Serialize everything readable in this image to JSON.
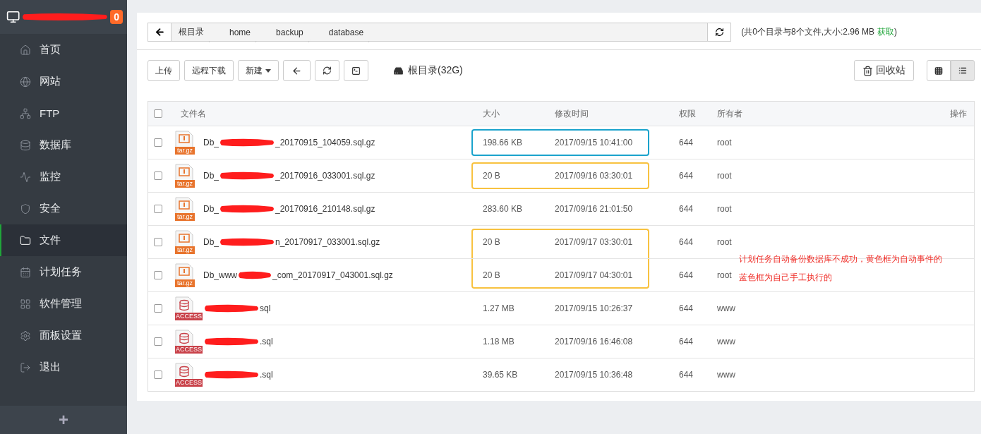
{
  "sidebar": {
    "badge": "0",
    "items": [
      {
        "label": "首页",
        "selected": false
      },
      {
        "label": "网站",
        "selected": false
      },
      {
        "label": "FTP",
        "selected": false
      },
      {
        "label": "数据库",
        "selected": false
      },
      {
        "label": "监控",
        "selected": false
      },
      {
        "label": "安全",
        "selected": false
      },
      {
        "label": "文件",
        "selected": true
      },
      {
        "label": "计划任务",
        "selected": false
      },
      {
        "label": "软件管理",
        "selected": false
      },
      {
        "label": "面板设置",
        "selected": false
      },
      {
        "label": "退出",
        "selected": false
      }
    ],
    "add": "+"
  },
  "breadcrumb": [
    "根目录",
    "home",
    "backup",
    "database"
  ],
  "summary": {
    "text": "(共0个目录与8个文件,大小:2.96 MB",
    "link": "获取",
    "close": ")"
  },
  "toolbar": {
    "buttons": [
      {
        "kind": "text",
        "label": "上传"
      },
      {
        "kind": "text",
        "label": "远程下载"
      },
      {
        "kind": "dropdown",
        "label": "新建"
      },
      {
        "kind": "back"
      },
      {
        "kind": "refresh"
      },
      {
        "kind": "terminal"
      }
    ],
    "disk": "根目录(32G)",
    "recycle": "回收站",
    "views": [
      {
        "kind": "grid",
        "selected": false
      },
      {
        "kind": "list",
        "selected": true
      }
    ]
  },
  "table": {
    "select_all": {
      "checked": false
    },
    "columns": [
      "文件名",
      "大小",
      "修改时间",
      "权限",
      "所有者",
      "操作"
    ],
    "rows": [
      {
        "kind": "archive",
        "type_label": "tar.gz",
        "name_start": "Db_",
        "name_end": "_20170915_104059.sql.gz",
        "size": "198.66 KB",
        "time": "2017/09/15 10:41:00",
        "perm": "644",
        "owner": "root",
        "checked": false,
        "color": "#1ba3cc",
        "joined_below": false
      },
      {
        "kind": "archive",
        "type_label": "tar.gz",
        "name_start": "Db_",
        "name_end": "_20170916_033001.sql.gz",
        "size": "20 B",
        "time": "2017/09/16 03:30:01",
        "perm": "644",
        "owner": "root",
        "checked": false,
        "color": "#f8c240",
        "joined_below": false
      },
      {
        "kind": "archive",
        "type_label": "tar.gz",
        "name_start": "Db_",
        "name_end": "_20170916_210148.sql.gz",
        "size": "283.60 KB",
        "time": "2017/09/16 21:01:50",
        "perm": "644",
        "owner": "root",
        "checked": false
      },
      {
        "kind": "archive",
        "type_label": "tar.gz",
        "name_start": "Db_",
        "name_end": "n_20170917_033001.sql.gz",
        "size": "20 B",
        "time": "2017/09/17 03:30:01",
        "perm": "644",
        "owner": "root",
        "checked": false,
        "color": "#f8c240",
        "joined_below": true
      },
      {
        "kind": "archive",
        "type_label": "tar.gz",
        "name_start": "Db_www",
        "name_end": "_com_20170917_043001.sql.gz",
        "size": "20 B",
        "time": "2017/09/17 04:30:01",
        "perm": "644",
        "owner": "root",
        "checked": false,
        "color": "#f8c240",
        "joined_below": false
      },
      {
        "kind": "sql",
        "type_label": "ACCESS",
        "name_end": "sql",
        "size": "1.27 MB",
        "time": "2017/09/15 10:26:37",
        "perm": "644",
        "owner": "www",
        "checked": false
      },
      {
        "kind": "sql",
        "type_label": "ACCESS",
        "name_end": ".sql",
        "size": "1.18 MB",
        "time": "2017/09/16 16:46:08",
        "perm": "644",
        "owner": "www",
        "checked": false
      },
      {
        "kind": "sql",
        "type_label": "ACCESS",
        "name_end": ".sql",
        "size": "39.65 KB",
        "time": "2017/09/15 10:36:48",
        "perm": "644",
        "owner": "www",
        "checked": false
      }
    ]
  },
  "note": [
    "计划任务自动备份数据库不成功，黄色框为自动事件的",
    "蓝色框为自己手工执行的"
  ]
}
